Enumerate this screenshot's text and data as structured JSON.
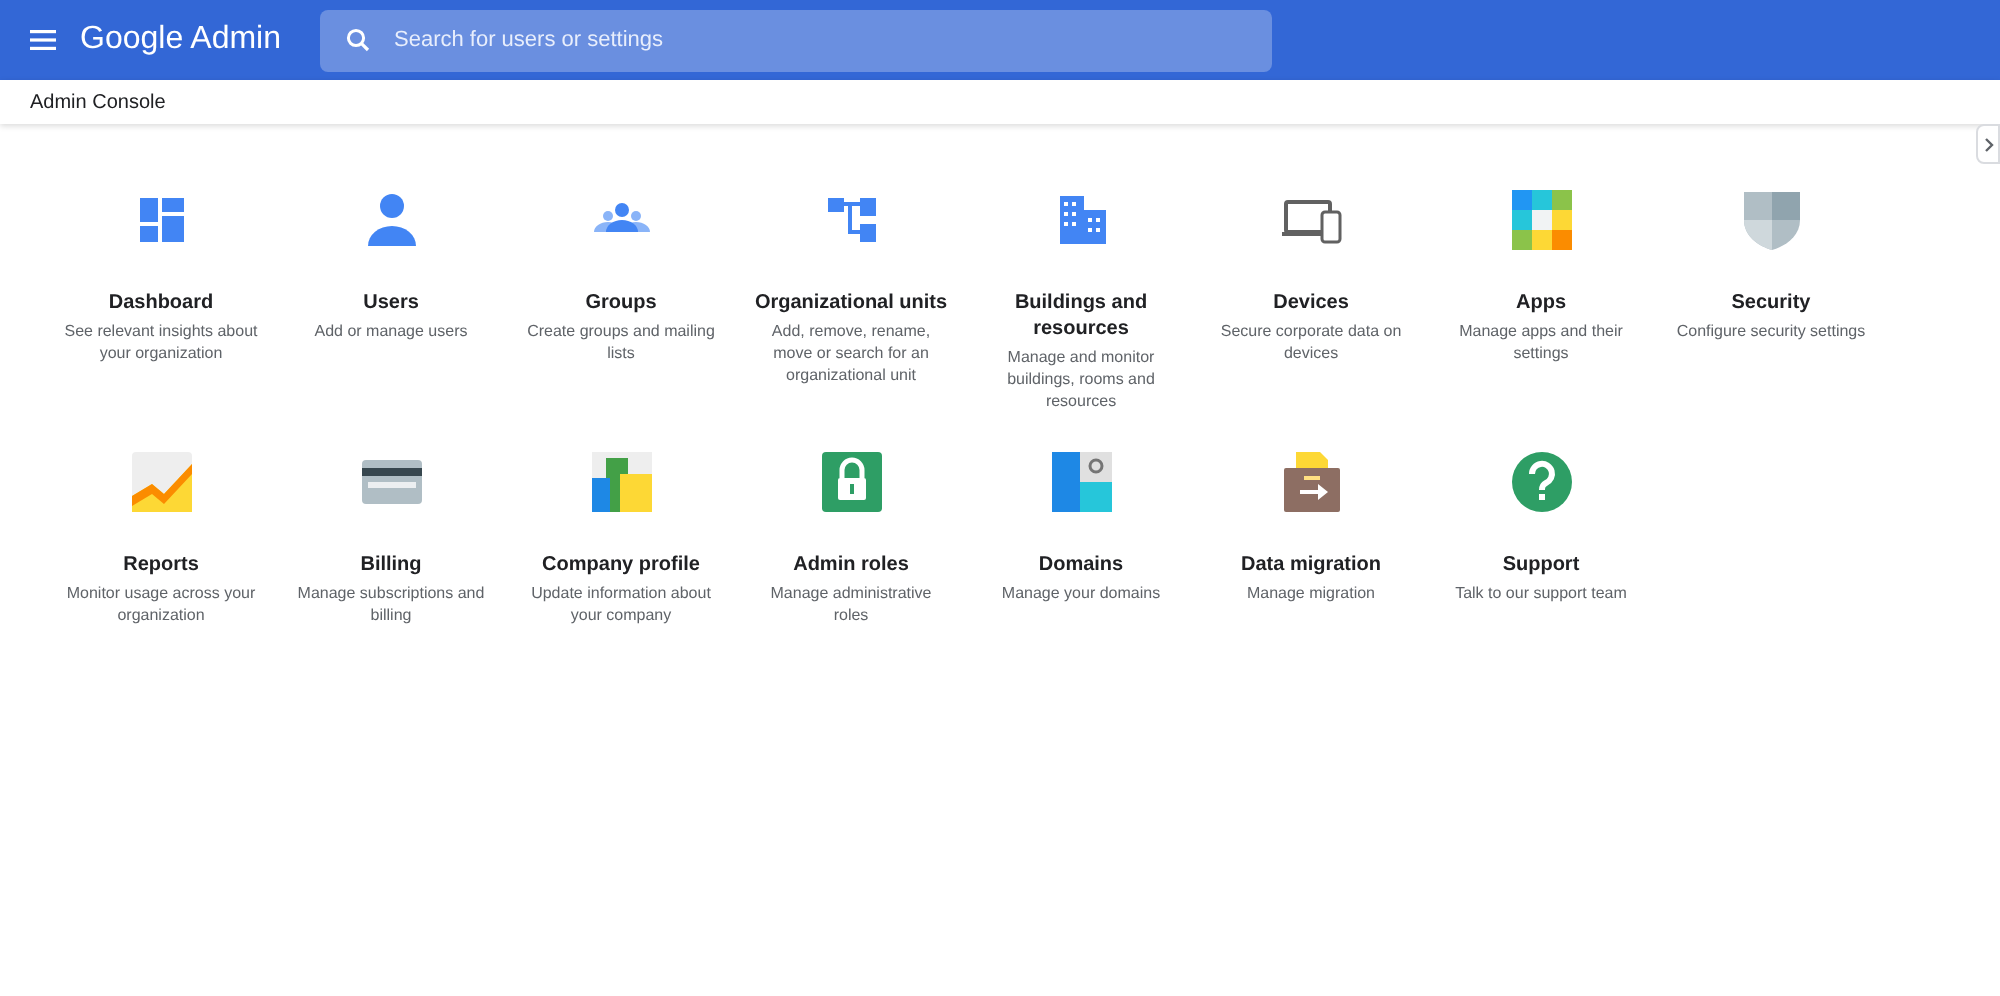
{
  "header": {
    "product": "Google Admin",
    "search": {
      "placeholder": "Search for users or settings"
    }
  },
  "breadcrumb": "Admin Console",
  "rows": [
    [
      {
        "kind": "dashboard",
        "title": "Dashboard",
        "description": "See relevant insights about your organization"
      },
      {
        "kind": "users",
        "title": "Users",
        "description": "Add or manage users"
      },
      {
        "kind": "groups",
        "title": "Groups",
        "description": "Create groups and mailing lists"
      },
      {
        "kind": "org",
        "title": "Organizational units",
        "description": "Add, remove, rename, move or search for an organizational unit"
      },
      {
        "kind": "buildings",
        "title": "Buildings and resources",
        "description": "Manage and monitor buildings, rooms and resources"
      },
      {
        "kind": "devices",
        "title": "Devices",
        "description": "Secure corporate data on devices"
      },
      {
        "kind": "apps",
        "title": "Apps",
        "description": "Manage apps and their settings"
      },
      {
        "kind": "security",
        "title": "Security",
        "description": "Configure security settings"
      }
    ],
    [
      {
        "kind": "reports",
        "title": "Reports",
        "description": "Monitor usage across your organization"
      },
      {
        "kind": "billing",
        "title": "Billing",
        "description": "Manage subscriptions and billing"
      },
      {
        "kind": "company",
        "title": "Company profile",
        "description": "Update information about your company"
      },
      {
        "kind": "roles",
        "title": "Admin roles",
        "description": "Manage administrative roles"
      },
      {
        "kind": "domains",
        "title": "Domains",
        "description": "Manage your domains"
      },
      {
        "kind": "migration",
        "title": "Data migration",
        "description": "Manage migration"
      },
      {
        "kind": "support",
        "title": "Support",
        "description": "Talk to our support team"
      }
    ]
  ]
}
